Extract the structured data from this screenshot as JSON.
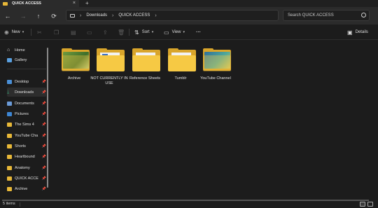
{
  "window": {
    "tab_title": "QUICK ACCESS",
    "tab_close": "×",
    "new_tab": "+"
  },
  "nav": {
    "back": "←",
    "forward": "→",
    "up": "↑",
    "refresh": "⟳",
    "breadcrumb": [
      "Downloads",
      "QUICK ACCESS"
    ],
    "sep": "›",
    "search_placeholder": "Search QUICK ACCESS"
  },
  "toolbar": {
    "new_label": "New",
    "sort_label": "Sort",
    "view_label": "View",
    "more_label": "···",
    "details_label": "Details"
  },
  "sidebar": {
    "top": [
      {
        "label": "Home",
        "color": "#d8d8d8"
      },
      {
        "label": "Gallery",
        "color": "#5aa0e0"
      }
    ],
    "pinned": [
      {
        "label": "Desktop",
        "color": "#4a8fd6"
      },
      {
        "label": "Downloads",
        "color": "#2f9f6f"
      },
      {
        "label": "Documents",
        "color": "#6b9bd8"
      },
      {
        "label": "Pictures",
        "color": "#3d86d4"
      },
      {
        "label": "The Sims 4",
        "color": "#e8b838"
      },
      {
        "label": "YouTube Cha",
        "color": "#e8b838"
      },
      {
        "label": "Shorts",
        "color": "#e8b838"
      },
      {
        "label": "Heartbound",
        "color": "#e8b838"
      },
      {
        "label": "Anatomy",
        "color": "#e8b838"
      },
      {
        "label": "QUICK ACCES",
        "color": "#e8b838"
      },
      {
        "label": "Archive",
        "color": "#e8b838"
      }
    ],
    "pin_glyph": "📌"
  },
  "folders": [
    {
      "name": "Archive",
      "kind": "image",
      "img_color": "#5a8a3a"
    },
    {
      "name": "NOT CURRENTLY IN USE",
      "kind": "doc"
    },
    {
      "name": "Reference Sheets",
      "kind": "paper"
    },
    {
      "name": "Tumblr",
      "kind": "paper"
    },
    {
      "name": "YouTube Channel",
      "kind": "image",
      "img_color": "#3f8f8a"
    }
  ],
  "status": {
    "items_count": "5 items"
  },
  "colors": {
    "accent": "#e8b838",
    "background": "#1c1c1c"
  }
}
